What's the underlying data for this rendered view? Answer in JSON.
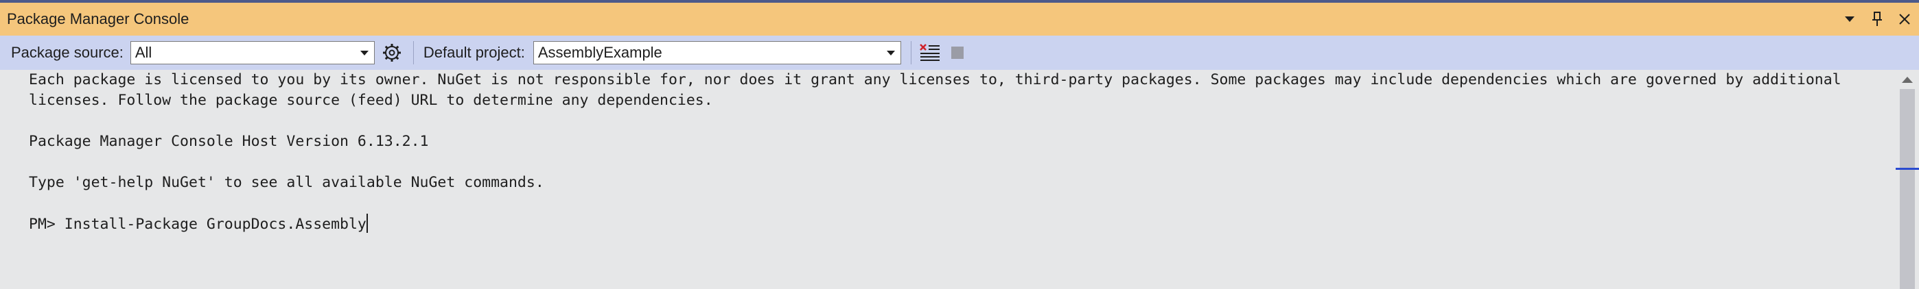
{
  "window": {
    "title": "Package Manager Console",
    "actions": {
      "dropdown_icon": "▼",
      "pin_icon": "📌",
      "close_icon": "✕"
    }
  },
  "toolbar": {
    "package_source_label": "Package source:",
    "package_source_value": "All",
    "default_project_label": "Default project:",
    "default_project_value": "AssemblyExample"
  },
  "console": {
    "lines": [
      "Each package is licensed to you by its owner. NuGet is not responsible for, nor does it grant any licenses to, third-party packages. Some packages may include dependencies which are governed by additional",
      "licenses. Follow the package source (feed) URL to determine any dependencies.",
      "Package Manager Console Host Version 6.13.2.1",
      "Type 'get-help NuGet' to see all available NuGet commands.",
      "PM> Install-Package GroupDocs.Assembly"
    ]
  },
  "colors": {
    "title_bar": "#f5c67c",
    "toolbar": "#cbd3f0",
    "console_bg": "#e6e7e8",
    "accent_top": "#4d5a8a",
    "scroll_marker": "#2a4bd0",
    "clear_icon_red": "#d0202a"
  }
}
